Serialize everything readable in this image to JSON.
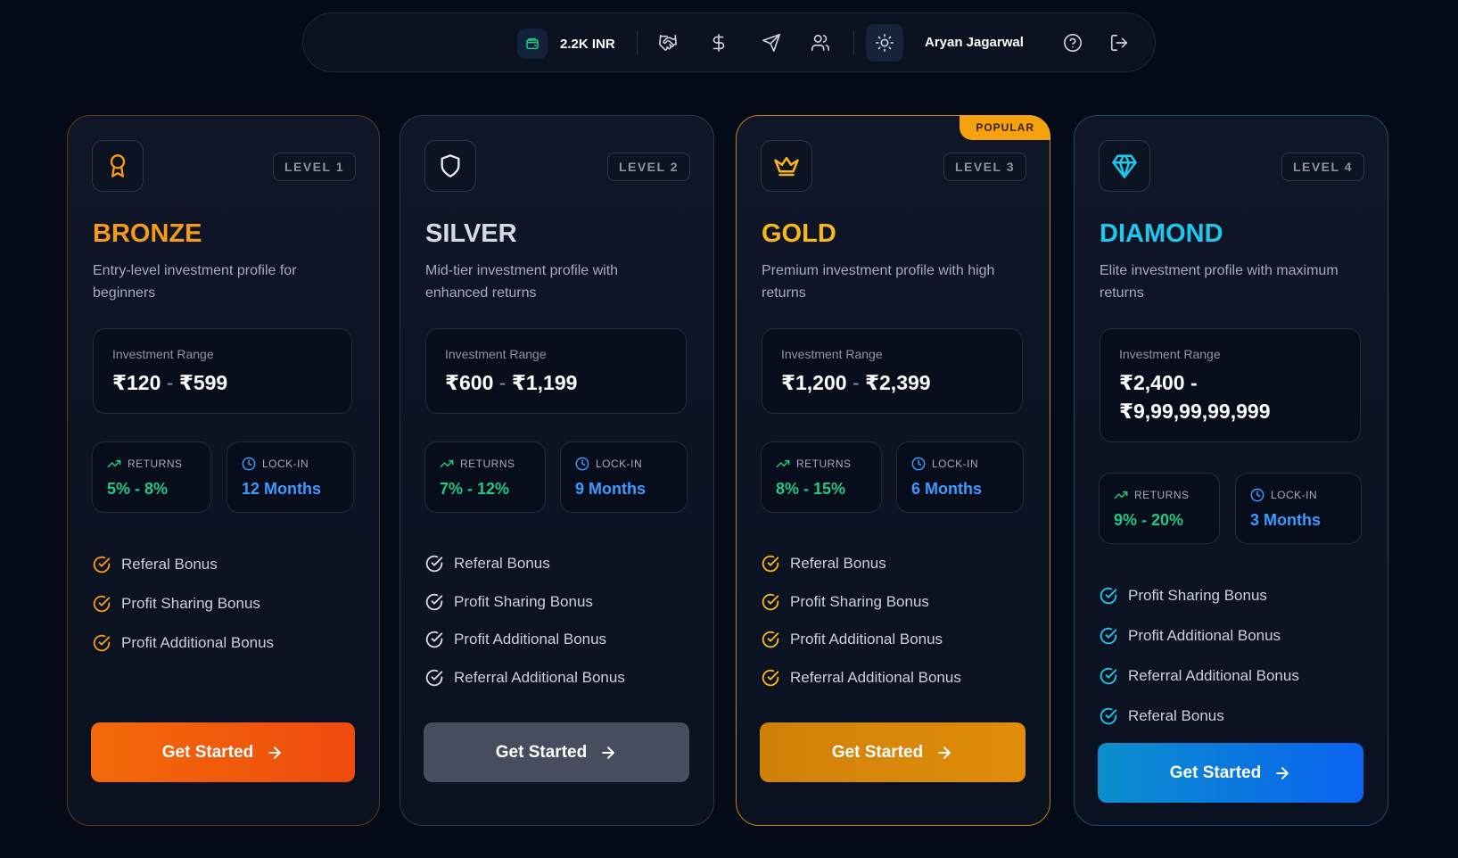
{
  "header": {
    "wallet_amount": "2.2K INR",
    "user_name": "Aryan Jagarwal",
    "icons": [
      "wallet-icon",
      "handshake-icon",
      "dollar-icon",
      "send-icon",
      "users-icon",
      "sun-icon",
      "help-icon",
      "logout-icon"
    ]
  },
  "colors": {
    "bronze": "#f79a18",
    "silver": "#d5dbe6",
    "gold": "#f7b818",
    "diamond": "#1ec8ea",
    "returns": "#22c883",
    "lockin": "#3c9bff"
  },
  "tiers": [
    {
      "level": "LEVEL 1",
      "name": "BRONZE",
      "description": "Entry-level investment profile for beginners",
      "range_label": "Investment Range",
      "range_min": "₹120",
      "range_sep": "-",
      "range_max": "₹599",
      "returns_label": "RETURNS",
      "returns_value": "5% - 8%",
      "lockin_label": "LOCK-IN",
      "lockin_value": "12 Months",
      "features": [
        "Referal Bonus",
        "Profit Sharing Bonus",
        "Profit Additional Bonus"
      ],
      "cta": "Get Started"
    },
    {
      "level": "LEVEL 2",
      "name": "SILVER",
      "description": "Mid-tier investment profile with enhanced returns",
      "range_label": "Investment Range",
      "range_min": "₹600",
      "range_sep": "-",
      "range_max": "₹1,199",
      "returns_label": "RETURNS",
      "returns_value": "7% - 12%",
      "lockin_label": "LOCK-IN",
      "lockin_value": "9 Months",
      "features": [
        "Referal Bonus",
        "Profit Sharing Bonus",
        "Profit Additional Bonus",
        "Referral Additional Bonus"
      ],
      "cta": "Get Started"
    },
    {
      "level": "LEVEL 3",
      "name": "GOLD",
      "badge": "POPULAR",
      "description": "Premium investment profile with high returns",
      "range_label": "Investment Range",
      "range_min": "₹1,200",
      "range_sep": "-",
      "range_max": "₹2,399",
      "returns_label": "RETURNS",
      "returns_value": "8% - 15%",
      "lockin_label": "LOCK-IN",
      "lockin_value": "6 Months",
      "features": [
        "Referal Bonus",
        "Profit Sharing Bonus",
        "Profit Additional Bonus",
        "Referral Additional Bonus"
      ],
      "cta": "Get Started"
    },
    {
      "level": "LEVEL 4",
      "name": "DIAMOND",
      "description": "Elite investment profile with maximum returns",
      "range_label": "Investment Range",
      "range_min": "₹2,400",
      "range_sep": "-",
      "range_max": "₹9,99,99,99,999",
      "returns_label": "RETURNS",
      "returns_value": "9% - 20%",
      "lockin_label": "LOCK-IN",
      "lockin_value": "3 Months",
      "features": [
        "Profit Sharing Bonus",
        "Profit Additional Bonus",
        "Referral Additional Bonus",
        "Referal Bonus"
      ],
      "cta": "Get Started"
    }
  ]
}
